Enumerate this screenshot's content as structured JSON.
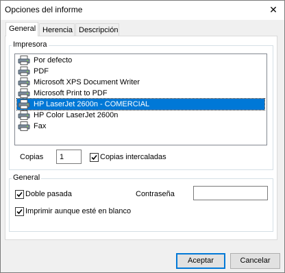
{
  "window": {
    "title": "Opciones del informe",
    "close_glyph": "✕"
  },
  "tabs": [
    {
      "label": "General",
      "active": true
    },
    {
      "label": "Herencia",
      "active": false
    },
    {
      "label": "Descripción",
      "active": false
    }
  ],
  "printer_group": {
    "title": "Impresora",
    "printers": [
      {
        "label": "Por defecto",
        "icon": "printer-icon",
        "selected": false
      },
      {
        "label": "PDF",
        "icon": "printer-icon",
        "selected": false
      },
      {
        "label": "Microsoft XPS Document Writer",
        "icon": "printer-icon",
        "selected": false
      },
      {
        "label": "Microsoft Print to PDF",
        "icon": "printer-icon",
        "selected": false
      },
      {
        "label": "HP LaserJet 2600n - COMERCIAL",
        "icon": "printer-icon",
        "selected": true
      },
      {
        "label": "HP Color LaserJet 2600n",
        "icon": "printer-icon",
        "selected": false
      },
      {
        "label": "Fax",
        "icon": "printer-icon",
        "selected": false
      }
    ],
    "copies_label": "Copias",
    "copies_value": "1",
    "collate_label": "Copias intercaladas",
    "collate_checked": true
  },
  "general_group": {
    "title": "General",
    "double_pass_label": "Doble pasada",
    "double_pass_checked": true,
    "password_label": "Contraseña",
    "password_value": "",
    "print_blank_label": "Imprimir aunque esté en blanco",
    "print_blank_checked": true
  },
  "buttons": {
    "accept": "Aceptar",
    "cancel": "Cancelar"
  },
  "colors": {
    "selection": "#0078d7",
    "dialog_bg": "#f0f0f0"
  }
}
